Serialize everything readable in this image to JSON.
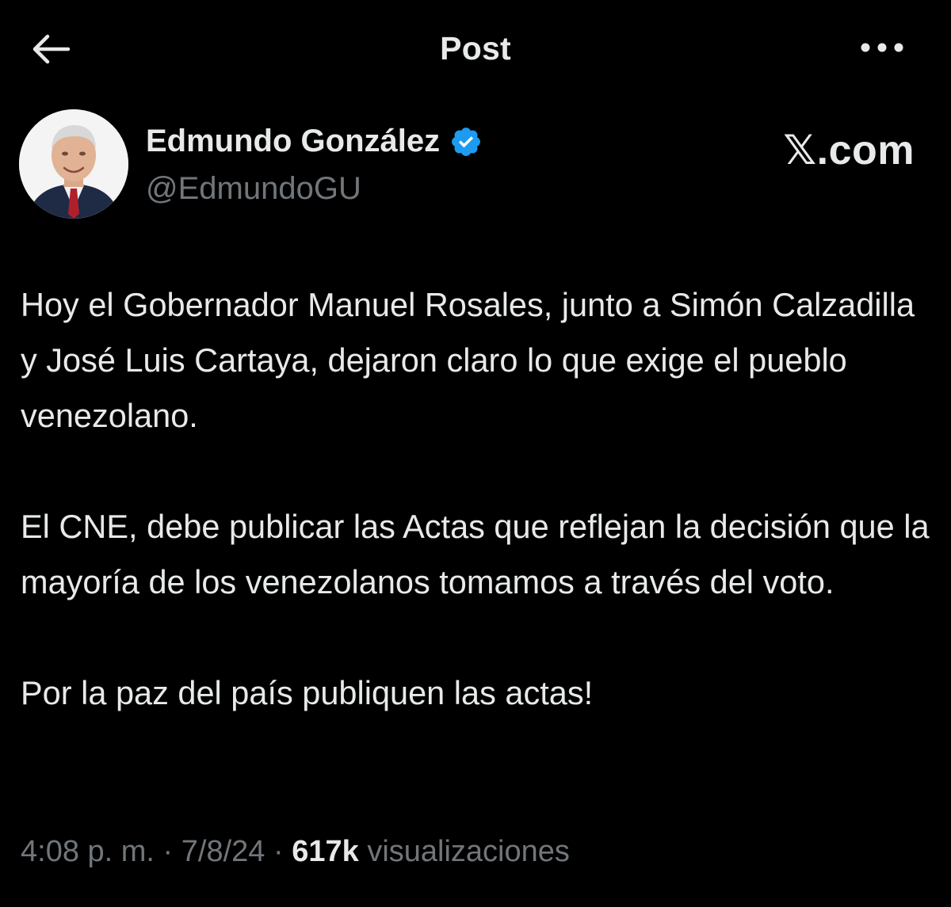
{
  "header": {
    "title": "Post",
    "back_icon": "arrow-left-icon",
    "more_icon": "more-horizontal-icon"
  },
  "author": {
    "name": "Edmundo González",
    "handle": "@EdmundoGU",
    "verified_icon": "verified-badge-icon",
    "verified_color": "#1d9bf0"
  },
  "watermark": "𝕏.com",
  "post": {
    "paragraphs": [
      "Hoy el Gobernador Manuel Rosales,  junto a Simón Calzadilla y José Luis Cartaya, dejaron claro lo que exige el pueblo venezolano.",
      "El CNE, debe publicar las Actas que reflejan la decisión que la mayoría de los venezolanos tomamos a través del voto.",
      "Por la paz del país publiquen las actas!"
    ]
  },
  "meta": {
    "time": "4:08 p. m.",
    "separator": "·",
    "date": "7/8/24",
    "views_count": "617k",
    "views_label": "visualizaciones"
  },
  "colors": {
    "background": "#000000",
    "text_primary": "#e7e9ea",
    "text_secondary": "#71767b"
  }
}
